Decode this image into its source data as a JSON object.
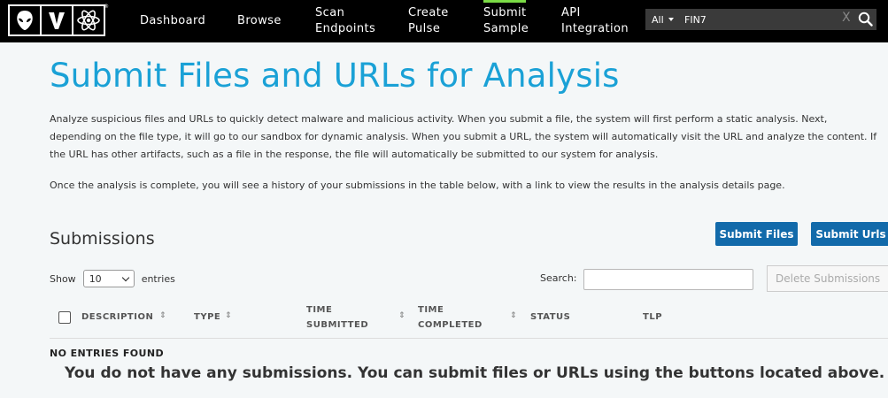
{
  "nav": {
    "items": [
      {
        "label": "Dashboard"
      },
      {
        "label": "Browse"
      },
      {
        "label": "Scan\nEndpoints"
      },
      {
        "label": "Create\nPulse"
      },
      {
        "label": "Submit\nSample"
      },
      {
        "label": "API\nIntegration"
      }
    ],
    "search_scope": "All",
    "search_value": "FIN7",
    "clear_label": "X"
  },
  "page": {
    "title": "Submit Files and URLs for Analysis",
    "paragraph1": "Analyze suspicious files and URLs to quickly detect malware and malicious activity. When you submit a file, the system will first perform a static analysis. Next, depending on the file type, it will go to our sandbox for dynamic analysis. When you submit a URL, the system will automatically visit the URL and analyze the content. If the URL has other artifacts, such as a file in the response, the file will automatically be submitted to our system for analysis.",
    "paragraph2": "Once the analysis is complete, you will see a history of your submissions in the table below, with a link to view the results in the analysis details page."
  },
  "submissions": {
    "title": "Submissions",
    "submit_files": "Submit Files",
    "submit_urls": "Submit Urls",
    "show_label": "Show",
    "entries_value": "10",
    "entries_label": "entries",
    "search_label": "Search:",
    "delete_label": "Delete Submissions",
    "columns": [
      "DESCRIPTION",
      "TYPE",
      "TIME\nSUBMITTED",
      "TIME\nCOMPLETED",
      "STATUS",
      "TLP"
    ],
    "empty_title": "NO ENTRIES FOUND",
    "empty_message": "You do not have any submissions. You can submit files or URLs using the buttons located above."
  },
  "colors": {
    "accent": "#1aa1d6",
    "button": "#126aaa",
    "active_nav": "#7bdc46"
  }
}
